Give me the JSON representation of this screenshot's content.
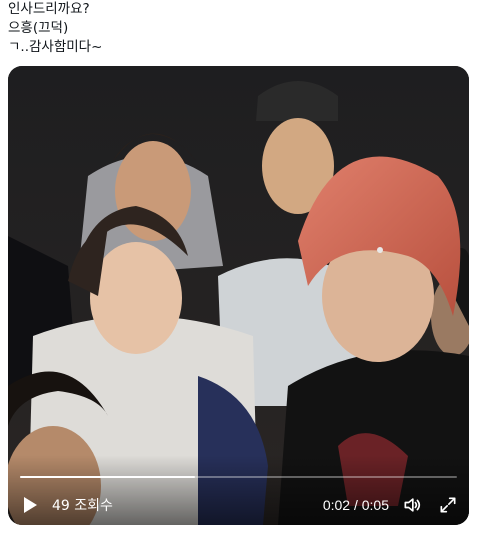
{
  "tweet": {
    "lines": [
      "인사드리까요?",
      "으흥(끄덕)",
      "ㄱ..감사함미다~"
    ]
  },
  "video": {
    "views_label": "49 조회수",
    "current_time": "0:02",
    "duration": "0:05",
    "time_separator": " / ",
    "progress_fraction": 0.4,
    "icons": {
      "play": "play-icon",
      "volume": "volume-icon",
      "fullscreen": "fullscreen-icon"
    }
  }
}
